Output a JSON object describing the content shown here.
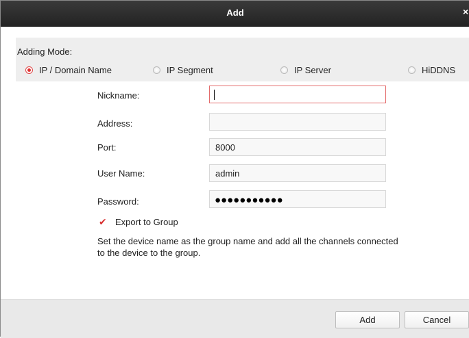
{
  "dialog": {
    "title": "Add",
    "close_symbol": "×"
  },
  "adding_mode": {
    "label": "Adding Mode:",
    "options": [
      {
        "label": "IP / Domain Name",
        "selected": true
      },
      {
        "label": "IP Segment",
        "selected": false
      },
      {
        "label": "IP Server",
        "selected": false
      },
      {
        "label": "HiDDNS",
        "selected": false
      }
    ]
  },
  "fields": {
    "nickname": {
      "label": "Nickname:",
      "value": ""
    },
    "address": {
      "label": "Address:",
      "value": ""
    },
    "port": {
      "label": "Port:",
      "value": "8000"
    },
    "username": {
      "label": "User Name:",
      "value": "admin"
    },
    "password": {
      "label": "Password:",
      "masked": "●●●●●●●●●●●"
    }
  },
  "export_group": {
    "label": "Export to Group",
    "checked": true,
    "help": "Set the device name as the group name and add all the channels connected to the device to the group."
  },
  "buttons": {
    "add": "Add",
    "cancel": "Cancel"
  },
  "colors": {
    "titlebar": "#2b2b2b",
    "accent_red": "#e03030",
    "panel_gray": "#eeeeee",
    "footer_gray": "#e9e9e9"
  }
}
